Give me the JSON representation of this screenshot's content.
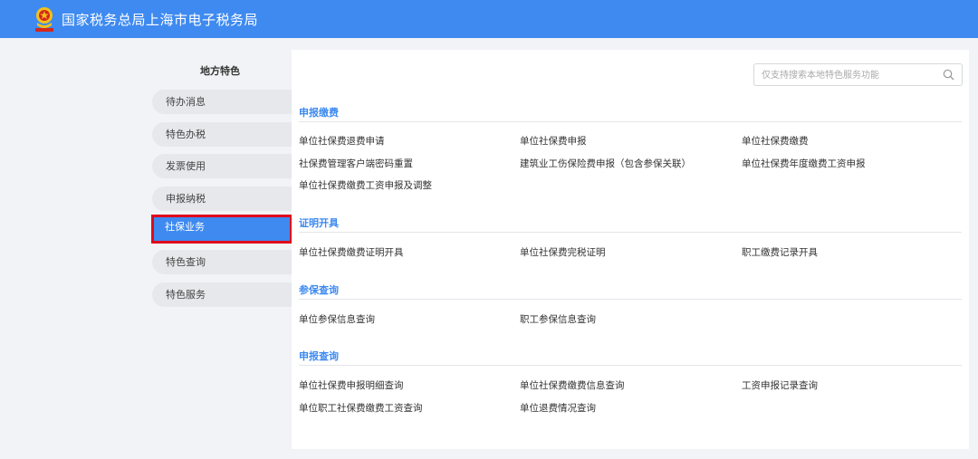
{
  "header": {
    "title": "国家税务总局上海市电子税务局"
  },
  "sidebar": {
    "title": "地方特色",
    "items": [
      {
        "label": "待办消息"
      },
      {
        "label": "特色办税"
      },
      {
        "label": "发票使用"
      },
      {
        "label": "申报纳税"
      },
      {
        "label": "社保业务",
        "active": true
      },
      {
        "label": "特色查询"
      },
      {
        "label": "特色服务"
      }
    ]
  },
  "search": {
    "placeholder": "仅支持搜索本地特色服务功能"
  },
  "sections": [
    {
      "title": "申报缴费",
      "items": [
        "单位社保费退费申请",
        "单位社保费申报",
        "单位社保费缴费",
        "社保费管理客户端密码重置",
        "建筑业工伤保险费申报（包含参保关联）",
        "单位社保费年度缴费工资申报",
        "单位社保费缴费工资申报及调整"
      ]
    },
    {
      "title": "证明开具",
      "items": [
        "单位社保费缴费证明开具",
        "单位社保费完税证明",
        "职工缴费记录开具"
      ]
    },
    {
      "title": "参保查询",
      "items": [
        "单位参保信息查询",
        "职工参保信息查询"
      ]
    },
    {
      "title": "申报查询",
      "items": [
        "单位社保费申报明细查询",
        "单位社保费缴费信息查询",
        "工资申报记录查询",
        "单位职工社保费缴费工资查询",
        "单位退费情况查询"
      ]
    }
  ],
  "colors": {
    "header_bg": "#3e8af0",
    "accent": "#3e8af0",
    "highlight_border": "#e0081b",
    "page_bg": "#f2f3f6"
  },
  "icons": {
    "emblem": "tax-emblem-icon",
    "search": "search-icon"
  }
}
